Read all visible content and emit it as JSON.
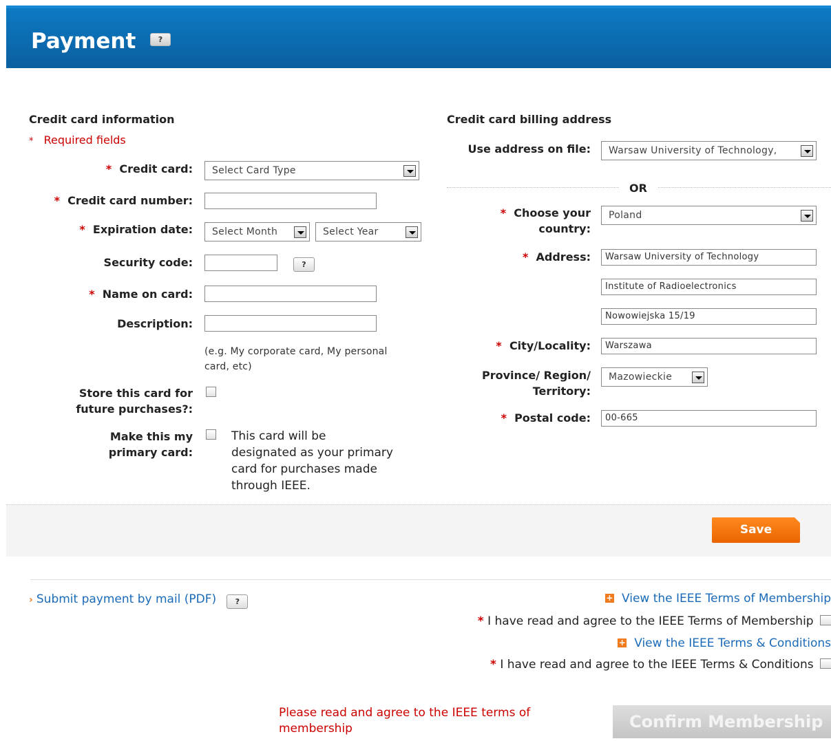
{
  "header": {
    "title": "Payment",
    "help": "?"
  },
  "card_info": {
    "title": "Credit card information",
    "required_note": "Required fields",
    "star": "*",
    "credit_card_label": "Credit card:",
    "credit_card_value": "Select Card Type",
    "card_number_label": "Credit card number:",
    "card_number_value": "",
    "expiration_label": "Expiration date:",
    "month_value": "Select Month",
    "year_value": "Select Year",
    "security_label": "Security code:",
    "security_value": "",
    "security_help": "?",
    "name_label": "Name on card:",
    "name_value": "",
    "description_label": "Description:",
    "description_value": "",
    "description_hint_1": "(e.g. My corporate card, My personal",
    "description_hint_2": "card, etc)",
    "store_label_1": "Store this card for",
    "store_label_2": "future purchases?:",
    "primary_label_1": "Make this my",
    "primary_label_2": "primary card:",
    "primary_text_1": "This card will be",
    "primary_text_2": "designated as your primary",
    "primary_text_3": "card for purchases made",
    "primary_text_4": "through IEEE."
  },
  "billing": {
    "title": "Credit card billing address",
    "use_address_label": "Use address on file:",
    "use_address_value": "Warsaw University of Technology,",
    "or_text": "OR",
    "star": "*",
    "country_label_1": "Choose your",
    "country_label_2": "country:",
    "country_value": "Poland",
    "address_label": "Address:",
    "address_1": "Warsaw University of Technology",
    "address_2": "Institute of Radioelectronics",
    "address_3": "Nowowiejska 15/19",
    "city_label": "City/Locality:",
    "city_value": "Warszawa",
    "province_label_1": "Province/ Region/",
    "province_label_2": "Territory:",
    "province_value": "Mazowieckie",
    "postal_label": "Postal code:",
    "postal_value": "00-665"
  },
  "actions": {
    "save": "Save",
    "mail_arrow": "›",
    "mail_link": "Submit payment by mail (PDF)",
    "mail_help": "?",
    "terms_membership_link": "View the IEEE Terms of Membership",
    "agree_membership": "I have read and agree to the IEEE Terms of Membership",
    "terms_conditions_link": "View the IEEE Terms & Conditions",
    "agree_conditions": "I have read and agree to the IEEE Terms & Conditions",
    "star": "*",
    "plus": "+",
    "error_1": "Please read and agree to the IEEE terms of",
    "error_2": "membership",
    "confirm": "Confirm Membership"
  },
  "colors": {
    "header_blue": "#0b6db5",
    "required_red": "#cc0000",
    "save_orange": "#f07b1c",
    "link_blue": "#1a6ab8"
  }
}
